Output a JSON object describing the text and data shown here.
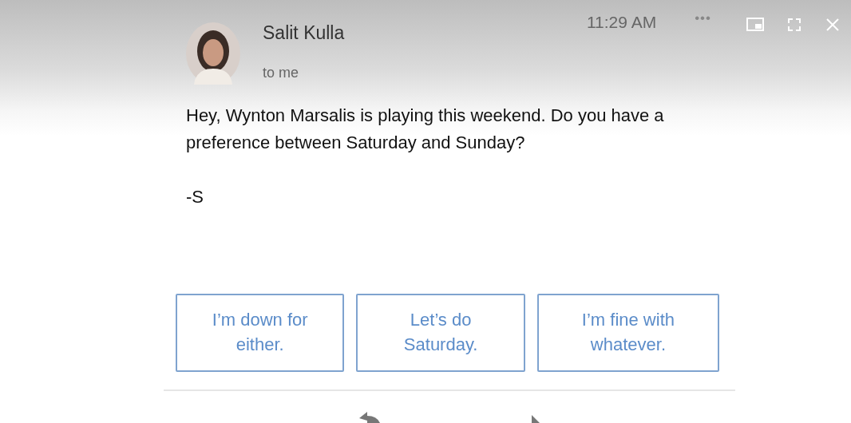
{
  "email": {
    "sender": "Salit Kulla",
    "recipient": "to me",
    "time": "11:29 AM",
    "more": "•••",
    "body": [
      "Hey, Wynton Marsalis is playing this weekend. Do you have a preference between Saturday and Sunday?",
      "-S"
    ]
  },
  "smart_replies": [
    {
      "label": "I’m down for either."
    },
    {
      "label": "Let’s do Saturday."
    },
    {
      "label": "I’m fine with whatever."
    }
  ]
}
